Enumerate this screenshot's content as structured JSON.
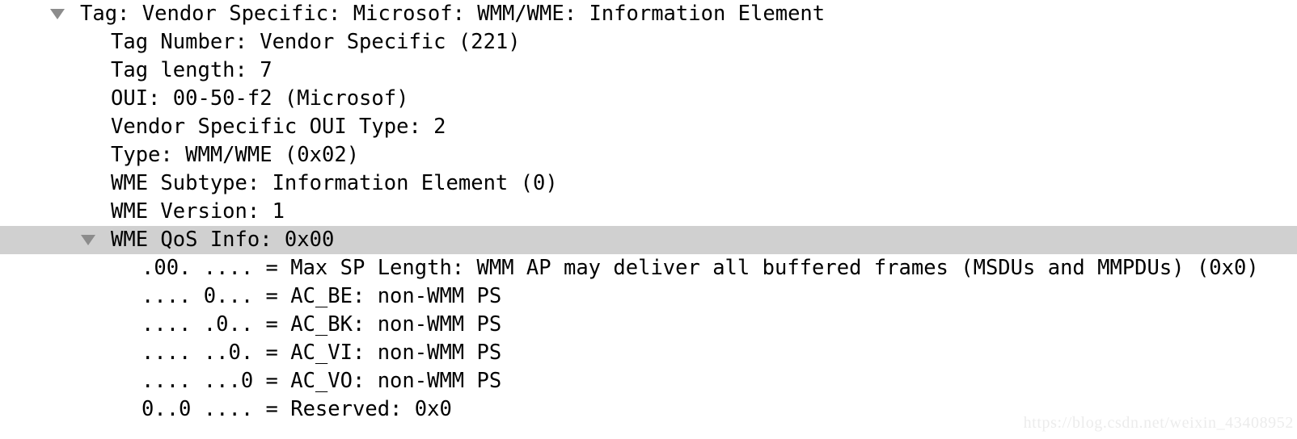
{
  "view": {
    "name": "packet-details-tree",
    "background_color": "#ffffff",
    "text_color": "#000000",
    "selection_color": "#d0d0d0",
    "twisty_color": "#8c8c8c"
  },
  "rows": [
    {
      "level": 1,
      "expander": "triangle-down",
      "selected": false,
      "text": "Tag: Vendor Specific: Microsof: WMM/WME: Information Element"
    },
    {
      "level": 2,
      "expander": "none",
      "selected": false,
      "text": "Tag Number: Vendor Specific (221)"
    },
    {
      "level": 2,
      "expander": "none",
      "selected": false,
      "text": "Tag length: 7"
    },
    {
      "level": 2,
      "expander": "none",
      "selected": false,
      "text": "OUI: 00-50-f2 (Microsof)"
    },
    {
      "level": 2,
      "expander": "none",
      "selected": false,
      "text": "Vendor Specific OUI Type: 2"
    },
    {
      "level": 2,
      "expander": "none",
      "selected": false,
      "text": "Type: WMM/WME (0x02)"
    },
    {
      "level": 2,
      "expander": "none",
      "selected": false,
      "text": "WME Subtype: Information Element (0)"
    },
    {
      "level": 2,
      "expander": "none",
      "selected": false,
      "text": "WME Version: 1"
    },
    {
      "level": 2,
      "expander": "triangle-down",
      "selected": true,
      "text": "WME QoS Info: 0x00"
    },
    {
      "level": 3,
      "expander": "none",
      "selected": false,
      "text": ".00. .... = Max SP Length: WMM AP may deliver all buffered frames (MSDUs and MMPDUs) (0x0)"
    },
    {
      "level": 3,
      "expander": "none",
      "selected": false,
      "text": ".... 0... = AC_BE: non-WMM PS"
    },
    {
      "level": 3,
      "expander": "none",
      "selected": false,
      "text": ".... .0.. = AC_BK: non-WMM PS"
    },
    {
      "level": 3,
      "expander": "none",
      "selected": false,
      "text": ".... ..0. = AC_VI: non-WMM PS"
    },
    {
      "level": 3,
      "expander": "none",
      "selected": false,
      "text": ".... ...0 = AC_VO: non-WMM PS"
    },
    {
      "level": 3,
      "expander": "none",
      "selected": false,
      "text": "0..0 .... = Reserved: 0x0"
    }
  ],
  "watermark": {
    "text": "https://blog.csdn.net/weixin_43408952"
  }
}
